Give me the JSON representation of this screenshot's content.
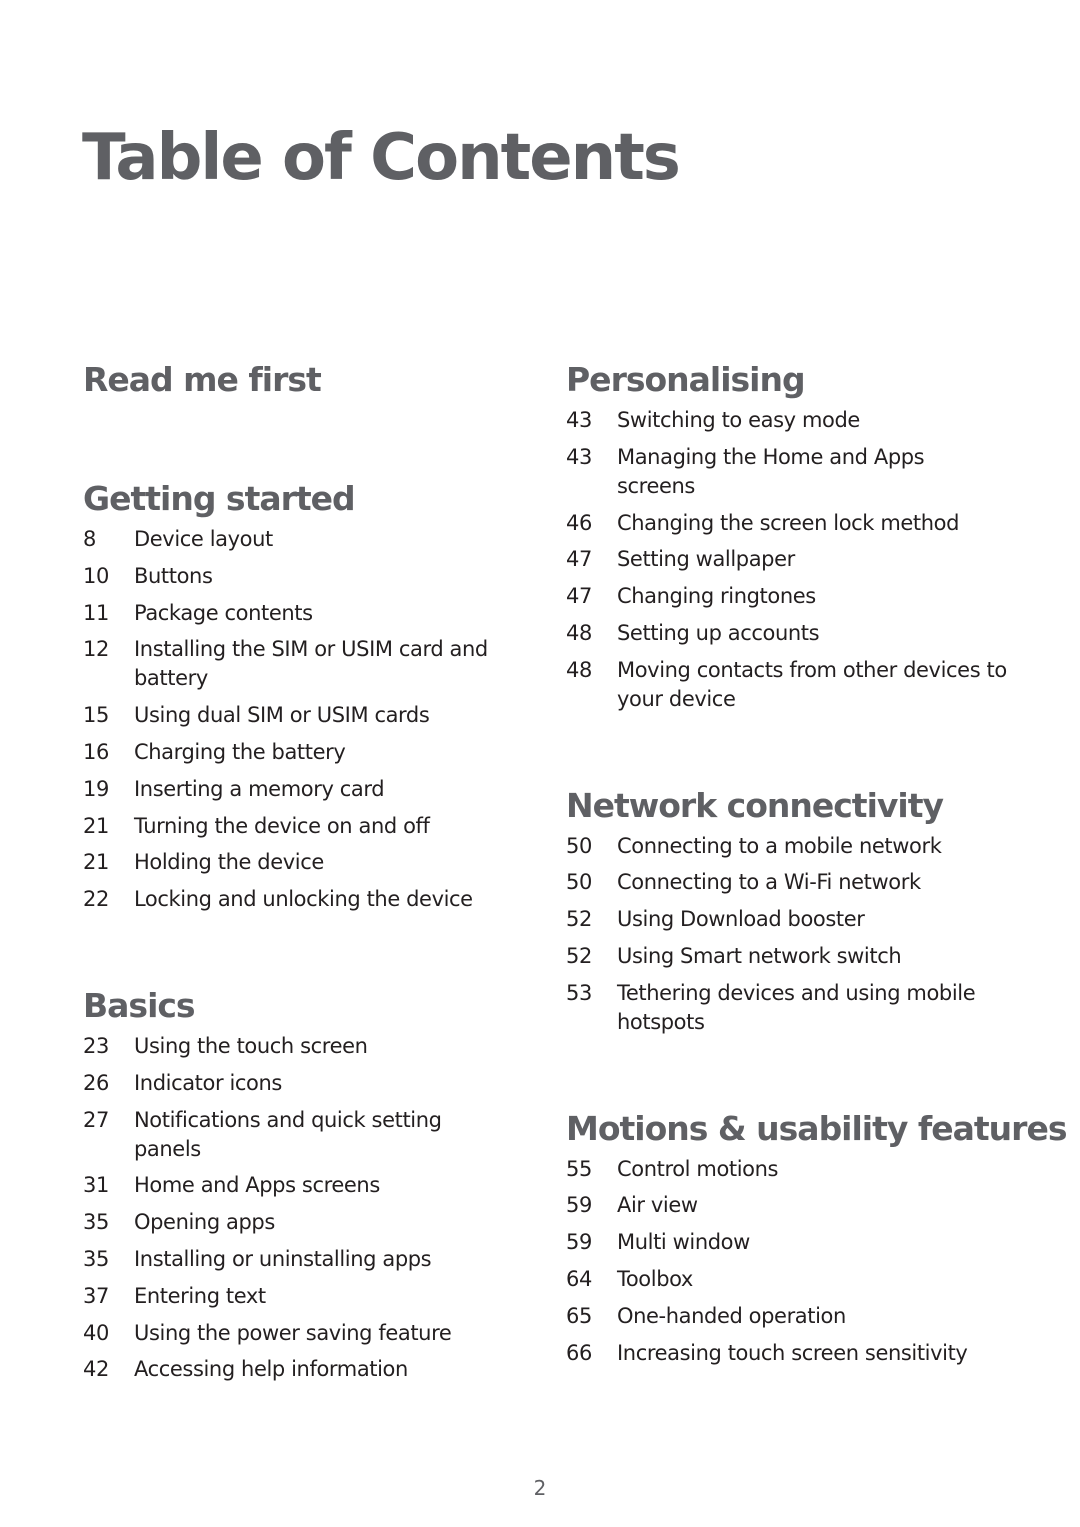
{
  "title": "Table of Contents",
  "left_column": [
    {
      "heading": "Read me first",
      "entries": []
    },
    {
      "heading": "Getting started",
      "entries": [
        {
          "page": "8",
          "title": "Device layout"
        },
        {
          "page": "10",
          "title": "Buttons"
        },
        {
          "page": "11",
          "title": "Package contents"
        },
        {
          "page": "12",
          "title": "Installing the SIM or USIM card and battery"
        },
        {
          "page": "15",
          "title": "Using dual SIM or USIM cards"
        },
        {
          "page": "16",
          "title": "Charging the battery"
        },
        {
          "page": "19",
          "title": "Inserting a memory card"
        },
        {
          "page": "21",
          "title": "Turning the device on and off"
        },
        {
          "page": "21",
          "title": "Holding the device"
        },
        {
          "page": "22",
          "title": "Locking and unlocking the device"
        }
      ]
    },
    {
      "heading": "Basics",
      "entries": [
        {
          "page": "23",
          "title": "Using the touch screen"
        },
        {
          "page": "26",
          "title": "Indicator icons"
        },
        {
          "page": "27",
          "title": "Notifications and quick setting panels"
        },
        {
          "page": "31",
          "title": "Home and Apps screens"
        },
        {
          "page": "35",
          "title": "Opening apps"
        },
        {
          "page": "35",
          "title": "Installing or uninstalling apps"
        },
        {
          "page": "37",
          "title": "Entering text"
        },
        {
          "page": "40",
          "title": "Using the power saving feature"
        },
        {
          "page": "42",
          "title": "Accessing help information"
        }
      ]
    }
  ],
  "right_column": [
    {
      "heading": "Personalising",
      "entries": [
        {
          "page": "43",
          "title": "Switching to easy mode"
        },
        {
          "page": "43",
          "title": "Managing the Home and Apps screens"
        },
        {
          "page": "46",
          "title": "Changing the screen lock method"
        },
        {
          "page": "47",
          "title": "Setting wallpaper"
        },
        {
          "page": "47",
          "title": "Changing ringtones"
        },
        {
          "page": "48",
          "title": "Setting up accounts"
        },
        {
          "page": "48",
          "title": "Moving contacts from other devices to your device"
        }
      ]
    },
    {
      "heading": "Network connectivity",
      "entries": [
        {
          "page": "50",
          "title": "Connecting to a mobile network"
        },
        {
          "page": "50",
          "title": "Connecting to a Wi-Fi network"
        },
        {
          "page": "52",
          "title": "Using Download booster"
        },
        {
          "page": "52",
          "title": "Using Smart network switch"
        },
        {
          "page": "53",
          "title": "Tethering devices and using mobile hotspots"
        }
      ]
    },
    {
      "heading": "Motions & usability features",
      "entries": [
        {
          "page": "55",
          "title": "Control motions"
        },
        {
          "page": "59",
          "title": "Air view"
        },
        {
          "page": "59",
          "title": "Multi window"
        },
        {
          "page": "64",
          "title": "Toolbox"
        },
        {
          "page": "65",
          "title": "One-handed operation"
        },
        {
          "page": "66",
          "title": "Increasing touch screen sensitivity"
        }
      ]
    }
  ],
  "footer": {
    "page_number": "2"
  }
}
